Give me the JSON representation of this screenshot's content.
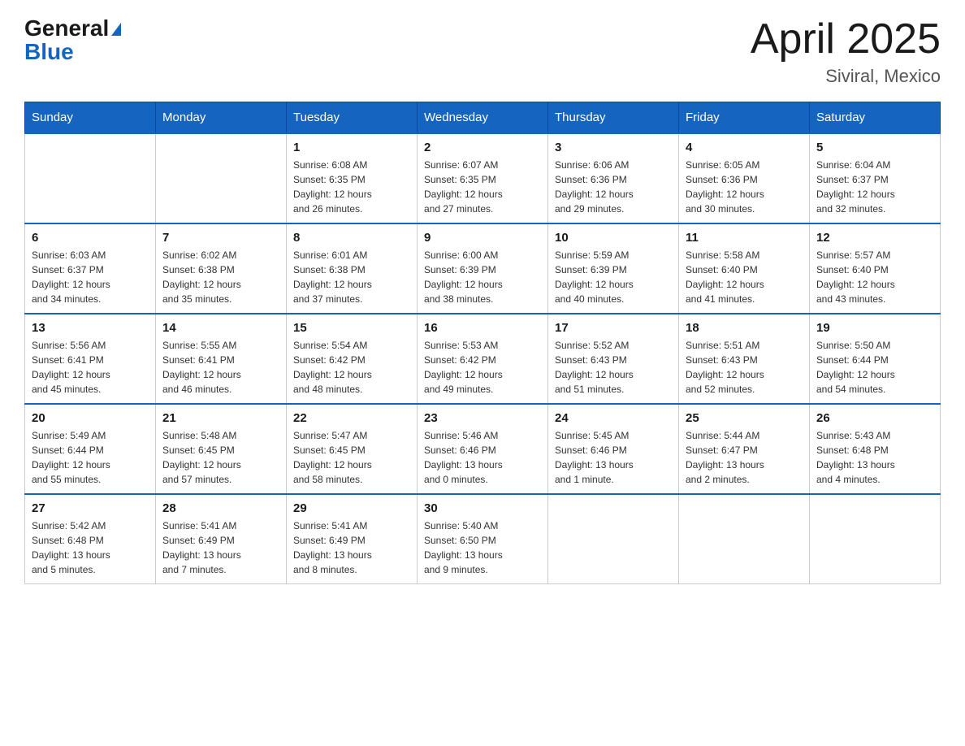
{
  "header": {
    "logo_general": "General",
    "logo_blue": "Blue",
    "month_year": "April 2025",
    "location": "Siviral, Mexico"
  },
  "days_of_week": [
    "Sunday",
    "Monday",
    "Tuesday",
    "Wednesday",
    "Thursday",
    "Friday",
    "Saturday"
  ],
  "weeks": [
    [
      {
        "day": "",
        "info": ""
      },
      {
        "day": "",
        "info": ""
      },
      {
        "day": "1",
        "info": "Sunrise: 6:08 AM\nSunset: 6:35 PM\nDaylight: 12 hours\nand 26 minutes."
      },
      {
        "day": "2",
        "info": "Sunrise: 6:07 AM\nSunset: 6:35 PM\nDaylight: 12 hours\nand 27 minutes."
      },
      {
        "day": "3",
        "info": "Sunrise: 6:06 AM\nSunset: 6:36 PM\nDaylight: 12 hours\nand 29 minutes."
      },
      {
        "day": "4",
        "info": "Sunrise: 6:05 AM\nSunset: 6:36 PM\nDaylight: 12 hours\nand 30 minutes."
      },
      {
        "day": "5",
        "info": "Sunrise: 6:04 AM\nSunset: 6:37 PM\nDaylight: 12 hours\nand 32 minutes."
      }
    ],
    [
      {
        "day": "6",
        "info": "Sunrise: 6:03 AM\nSunset: 6:37 PM\nDaylight: 12 hours\nand 34 minutes."
      },
      {
        "day": "7",
        "info": "Sunrise: 6:02 AM\nSunset: 6:38 PM\nDaylight: 12 hours\nand 35 minutes."
      },
      {
        "day": "8",
        "info": "Sunrise: 6:01 AM\nSunset: 6:38 PM\nDaylight: 12 hours\nand 37 minutes."
      },
      {
        "day": "9",
        "info": "Sunrise: 6:00 AM\nSunset: 6:39 PM\nDaylight: 12 hours\nand 38 minutes."
      },
      {
        "day": "10",
        "info": "Sunrise: 5:59 AM\nSunset: 6:39 PM\nDaylight: 12 hours\nand 40 minutes."
      },
      {
        "day": "11",
        "info": "Sunrise: 5:58 AM\nSunset: 6:40 PM\nDaylight: 12 hours\nand 41 minutes."
      },
      {
        "day": "12",
        "info": "Sunrise: 5:57 AM\nSunset: 6:40 PM\nDaylight: 12 hours\nand 43 minutes."
      }
    ],
    [
      {
        "day": "13",
        "info": "Sunrise: 5:56 AM\nSunset: 6:41 PM\nDaylight: 12 hours\nand 45 minutes."
      },
      {
        "day": "14",
        "info": "Sunrise: 5:55 AM\nSunset: 6:41 PM\nDaylight: 12 hours\nand 46 minutes."
      },
      {
        "day": "15",
        "info": "Sunrise: 5:54 AM\nSunset: 6:42 PM\nDaylight: 12 hours\nand 48 minutes."
      },
      {
        "day": "16",
        "info": "Sunrise: 5:53 AM\nSunset: 6:42 PM\nDaylight: 12 hours\nand 49 minutes."
      },
      {
        "day": "17",
        "info": "Sunrise: 5:52 AM\nSunset: 6:43 PM\nDaylight: 12 hours\nand 51 minutes."
      },
      {
        "day": "18",
        "info": "Sunrise: 5:51 AM\nSunset: 6:43 PM\nDaylight: 12 hours\nand 52 minutes."
      },
      {
        "day": "19",
        "info": "Sunrise: 5:50 AM\nSunset: 6:44 PM\nDaylight: 12 hours\nand 54 minutes."
      }
    ],
    [
      {
        "day": "20",
        "info": "Sunrise: 5:49 AM\nSunset: 6:44 PM\nDaylight: 12 hours\nand 55 minutes."
      },
      {
        "day": "21",
        "info": "Sunrise: 5:48 AM\nSunset: 6:45 PM\nDaylight: 12 hours\nand 57 minutes."
      },
      {
        "day": "22",
        "info": "Sunrise: 5:47 AM\nSunset: 6:45 PM\nDaylight: 12 hours\nand 58 minutes."
      },
      {
        "day": "23",
        "info": "Sunrise: 5:46 AM\nSunset: 6:46 PM\nDaylight: 13 hours\nand 0 minutes."
      },
      {
        "day": "24",
        "info": "Sunrise: 5:45 AM\nSunset: 6:46 PM\nDaylight: 13 hours\nand 1 minute."
      },
      {
        "day": "25",
        "info": "Sunrise: 5:44 AM\nSunset: 6:47 PM\nDaylight: 13 hours\nand 2 minutes."
      },
      {
        "day": "26",
        "info": "Sunrise: 5:43 AM\nSunset: 6:48 PM\nDaylight: 13 hours\nand 4 minutes."
      }
    ],
    [
      {
        "day": "27",
        "info": "Sunrise: 5:42 AM\nSunset: 6:48 PM\nDaylight: 13 hours\nand 5 minutes."
      },
      {
        "day": "28",
        "info": "Sunrise: 5:41 AM\nSunset: 6:49 PM\nDaylight: 13 hours\nand 7 minutes."
      },
      {
        "day": "29",
        "info": "Sunrise: 5:41 AM\nSunset: 6:49 PM\nDaylight: 13 hours\nand 8 minutes."
      },
      {
        "day": "30",
        "info": "Sunrise: 5:40 AM\nSunset: 6:50 PM\nDaylight: 13 hours\nand 9 minutes."
      },
      {
        "day": "",
        "info": ""
      },
      {
        "day": "",
        "info": ""
      },
      {
        "day": "",
        "info": ""
      }
    ]
  ]
}
